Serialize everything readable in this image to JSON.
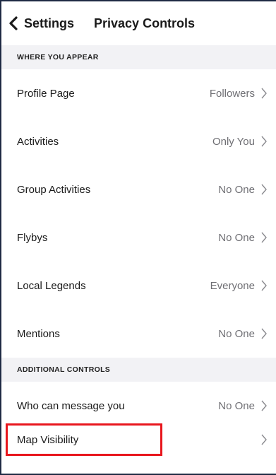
{
  "nav": {
    "back_label": "Settings",
    "title": "Privacy Controls"
  },
  "sections": [
    {
      "header": "WHERE YOU APPEAR",
      "items": [
        {
          "label": "Profile Page",
          "value": "Followers"
        },
        {
          "label": "Activities",
          "value": "Only You"
        },
        {
          "label": "Group Activities",
          "value": "No One"
        },
        {
          "label": "Flybys",
          "value": "No One"
        },
        {
          "label": "Local Legends",
          "value": "Everyone"
        },
        {
          "label": "Mentions",
          "value": "No One"
        }
      ]
    },
    {
      "header": "ADDITIONAL CONTROLS",
      "items": [
        {
          "label": "Who can message you",
          "value": "No One"
        },
        {
          "label": "Map Visibility",
          "value": ""
        }
      ]
    }
  ],
  "colors": {
    "highlight": "#e8161d",
    "section_bg": "#f2f2f5",
    "value_text": "#6f6f74"
  },
  "icons": {
    "back": "chevron-left-icon",
    "row": "chevron-right-icon"
  }
}
